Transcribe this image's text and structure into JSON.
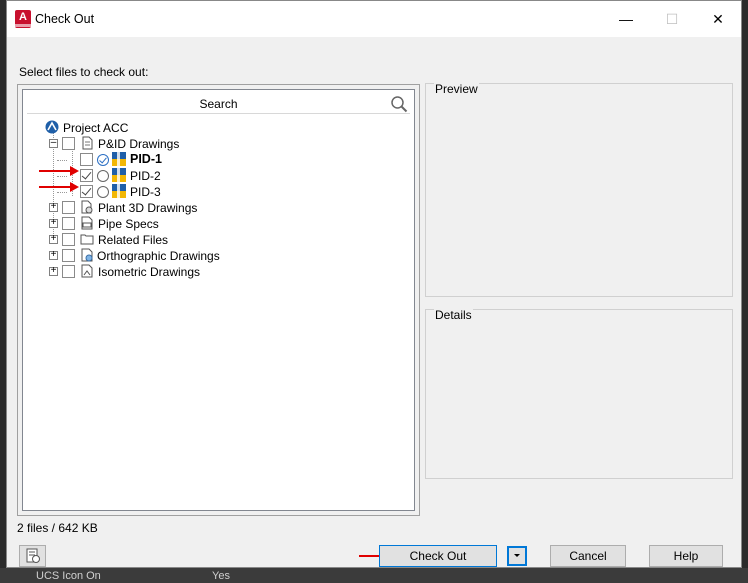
{
  "window": {
    "title": "Check Out",
    "app_icon": "autocad-icon",
    "app_icon_letter": "A",
    "controls": [
      "minimize",
      "maximize",
      "close"
    ]
  },
  "main": {
    "select_label": "Select files to check out:",
    "search": {
      "label": "Search"
    },
    "tree": {
      "root": {
        "label": "Project ACC",
        "icon": "acc-project-icon"
      },
      "pid_folder": {
        "label": "P&ID Drawings",
        "icon": "document-icon"
      },
      "pid_items": [
        {
          "label": "PID-1",
          "checked": false,
          "status": "checked-in",
          "bold": true
        },
        {
          "label": "PID-2",
          "checked": true,
          "status": "available",
          "bold": false
        },
        {
          "label": "PID-3",
          "checked": true,
          "status": "available",
          "bold": false
        }
      ],
      "folders": [
        {
          "label": "Plant 3D Drawings",
          "icon": "plant3d-icon"
        },
        {
          "label": "Pipe Specs",
          "icon": "pipe-spec-icon"
        },
        {
          "label": "Related Files",
          "icon": "folder-icon"
        },
        {
          "label": "Orthographic Drawings",
          "icon": "ortho-icon"
        },
        {
          "label": "Isometric Drawings",
          "icon": "iso-icon"
        }
      ]
    },
    "preview_label": "Preview",
    "details_label": "Details",
    "summary": "2 files / 642 KB"
  },
  "buttons": {
    "check_out": "Check Out",
    "cancel": "Cancel",
    "help": "Help"
  },
  "background": {
    "text_left": "UCS Icon On",
    "text_right": "Yes"
  },
  "colors": {
    "accent": "#0078d7",
    "annotation_arrow": "#e00000",
    "app_icon": "#c8102e"
  }
}
